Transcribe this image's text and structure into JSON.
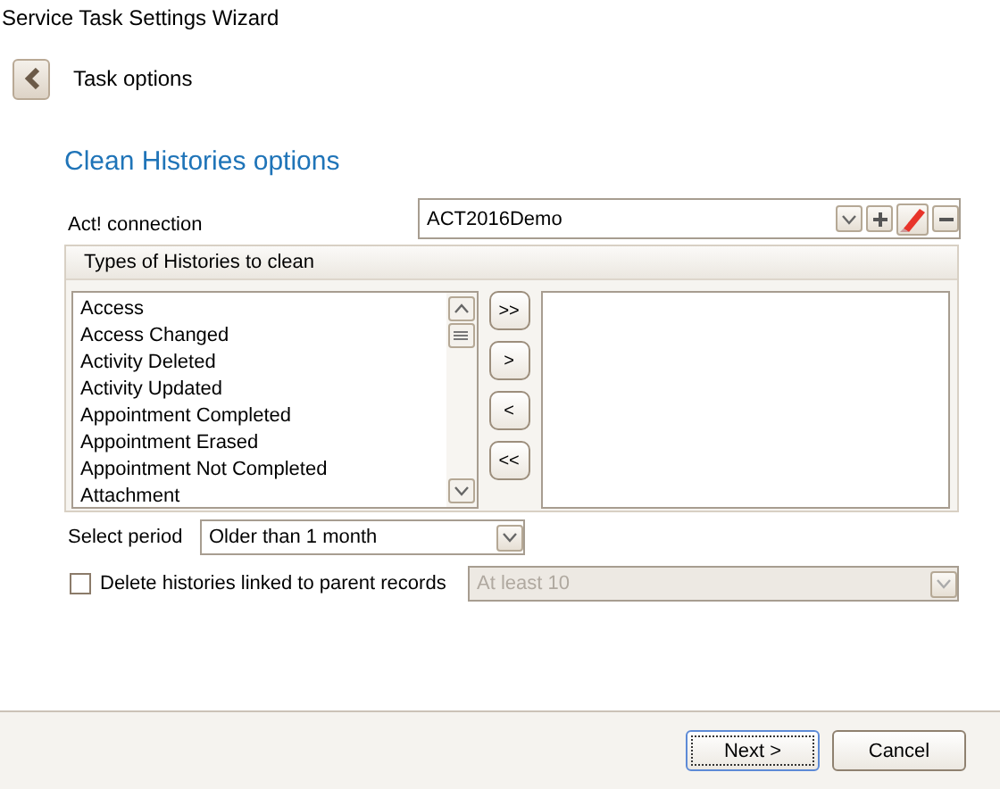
{
  "window": {
    "title": "Service Task Settings Wizard"
  },
  "header": {
    "title": "Task options"
  },
  "heading": "Clean Histories options",
  "connection": {
    "label": "Act! connection",
    "value": "ACT2016Demo"
  },
  "histories": {
    "title": "Types of Histories to clean",
    "available": [
      "Access",
      "Access Changed",
      "Activity Deleted",
      "Activity Updated",
      "Appointment Completed",
      "Appointment Erased",
      "Appointment Not Completed",
      "Attachment"
    ],
    "transfer_buttons": [
      ">>",
      ">",
      "<",
      "<<"
    ]
  },
  "period": {
    "label": "Select period",
    "value": "Older than 1 month"
  },
  "delete_linked": {
    "label": "Delete histories linked to parent records",
    "checked": false
  },
  "minimum": {
    "value": "At least 10",
    "disabled": true
  },
  "buttons": [
    {
      "label": "Next >",
      "default": true
    },
    {
      "label": "Cancel",
      "default": false
    }
  ]
}
